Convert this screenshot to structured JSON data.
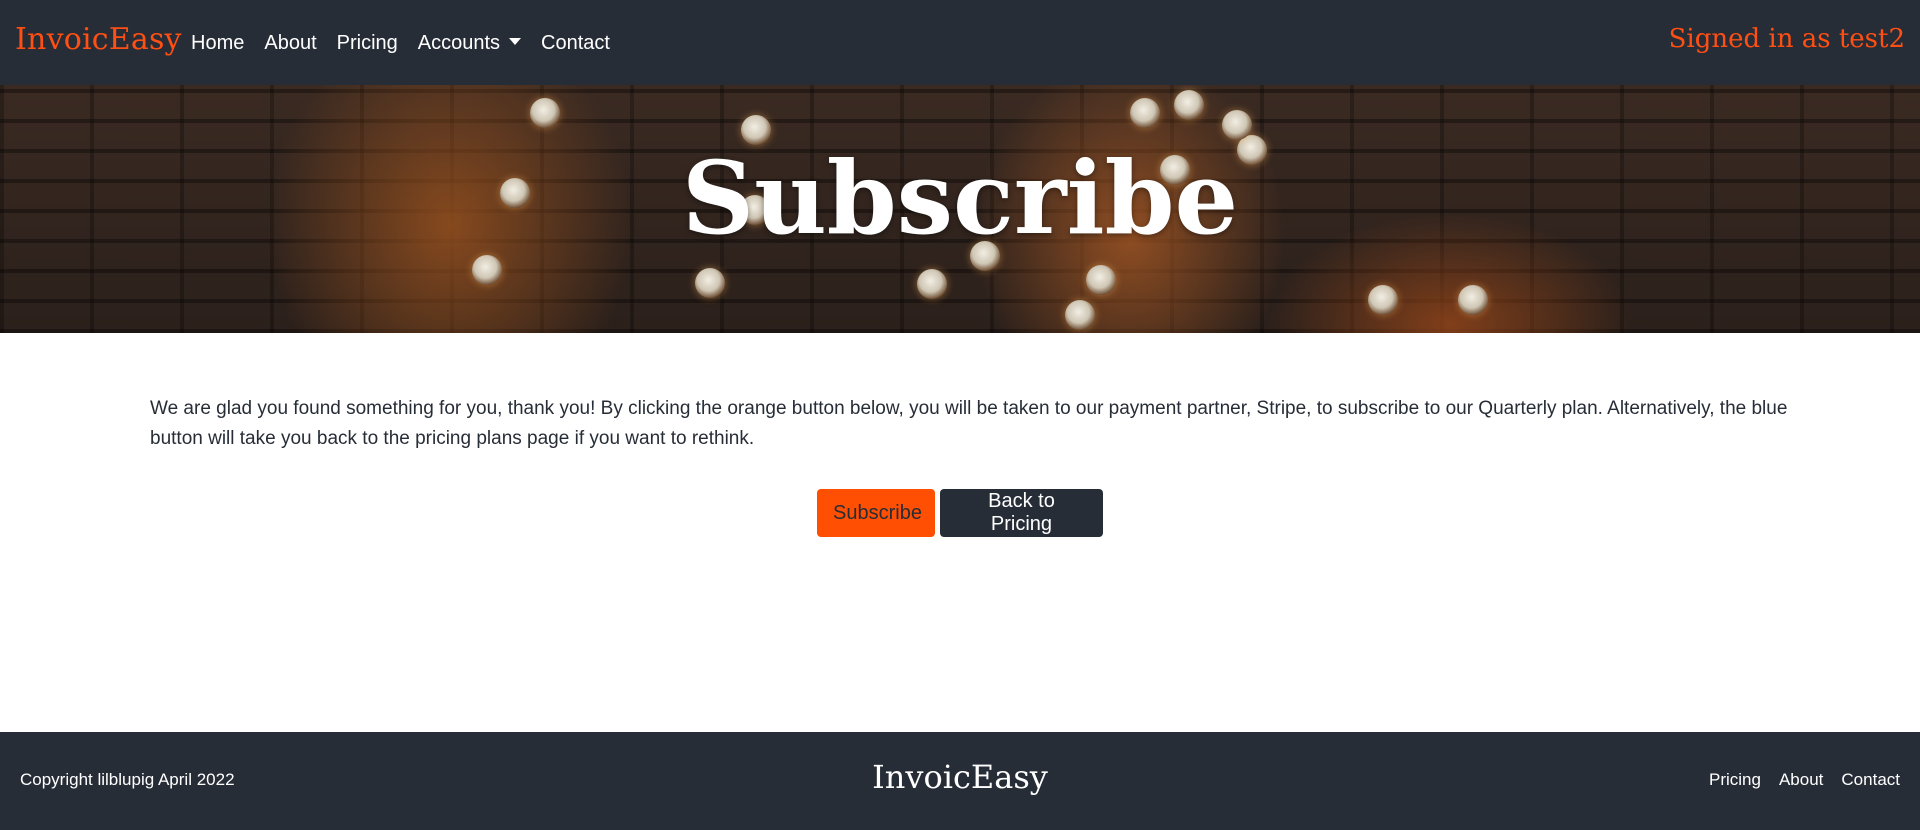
{
  "colors": {
    "navbar_bg": "#272d37",
    "accent": "#ff4f12",
    "subscribe_button": "#ff4f02",
    "back_button": "#272d37",
    "text": "#272d37"
  },
  "navbar": {
    "brand": "InvoicEasy",
    "links": [
      {
        "label": "Home"
      },
      {
        "label": "About"
      },
      {
        "label": "Pricing"
      },
      {
        "label": "Accounts",
        "icon": "caret-down-icon"
      },
      {
        "label": "Contact"
      }
    ],
    "signed_in": "Signed in as test2"
  },
  "hero": {
    "title": "Subscribe"
  },
  "main": {
    "intro": "We are glad you found something for you, thank you! By clicking the orange button below, you will be taken to our payment partner, Stripe, to subscribe to our Quarterly plan. Alternatively, the blue button will take you back to the pricing plans page if you want to rethink.",
    "subscribe_label": "Subscribe",
    "back_label": "Back to Pricing"
  },
  "footer": {
    "copyright": "Copyright lilblupig April 2022",
    "brand": "InvoicEasy",
    "links": [
      {
        "label": "Pricing"
      },
      {
        "label": "About"
      },
      {
        "label": "Contact"
      }
    ]
  }
}
